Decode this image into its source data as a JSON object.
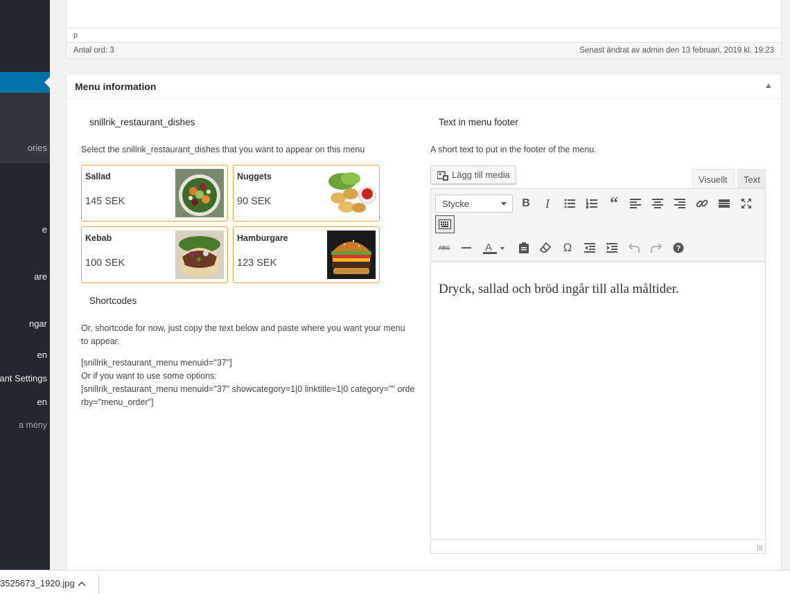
{
  "sidebar": {
    "items": [
      {
        "label": "ories",
        "type": "sub"
      },
      {
        "label": "e",
        "type": "main"
      },
      {
        "label": "are",
        "type": "main"
      },
      {
        "label": "ngar",
        "type": "main"
      },
      {
        "label": "en",
        "type": "main"
      },
      {
        "label": "ant Settings",
        "type": "main"
      },
      {
        "label": "en",
        "type": "main"
      },
      {
        "label": "a meny",
        "type": "collapse"
      }
    ]
  },
  "editor": {
    "path": "p",
    "word_count": "Antal ord: 3",
    "last_edited": "Senast ändrat av admin den 13 februari, 2019 kl. 19:23"
  },
  "postbox": {
    "title": "Menu information",
    "left": {
      "dishes_title": "snillrik_restaurant_dishes",
      "dishes_desc": "Select the snillrik_restaurant_dishes that you want to appear on this menu",
      "dishes": [
        {
          "name": "Sallad",
          "price": "145 SEK",
          "image": "salad"
        },
        {
          "name": "Nuggets",
          "price": "90 SEK",
          "image": "nuggets"
        },
        {
          "name": "Kebab",
          "price": "100 SEK",
          "image": "kebab"
        },
        {
          "name": "Hamburgare",
          "price": "123 SEK",
          "image": "burger"
        }
      ],
      "shortcodes_title": "Shortcodes",
      "shortcodes_desc": "Or, shortcode for now, just copy the text below and paste where you want your menu to appear.",
      "shortcode_1": "[snillrik_restaurant_menu menuid=\"37\"]",
      "shortcode_options_label": "Or if you want to use some options:",
      "shortcode_2": "[snillrik_restaurant_menu menuid=\"37\" showcategory=1|0 linktitle=1|0 category=\"\" orderby=\"menu_order\"]"
    },
    "right": {
      "footer_title": "Text in menu footer",
      "footer_desc": "A short text to put in the footer of the menu.",
      "add_media": "Lägg till media",
      "tab_visual": "Visuellt",
      "tab_text": "Text",
      "format_select": "Stycke",
      "content": "Dryck, sallad och bröd ingår till alla måltider."
    }
  },
  "download_bar": {
    "file": "3525673_1920.jpg"
  }
}
